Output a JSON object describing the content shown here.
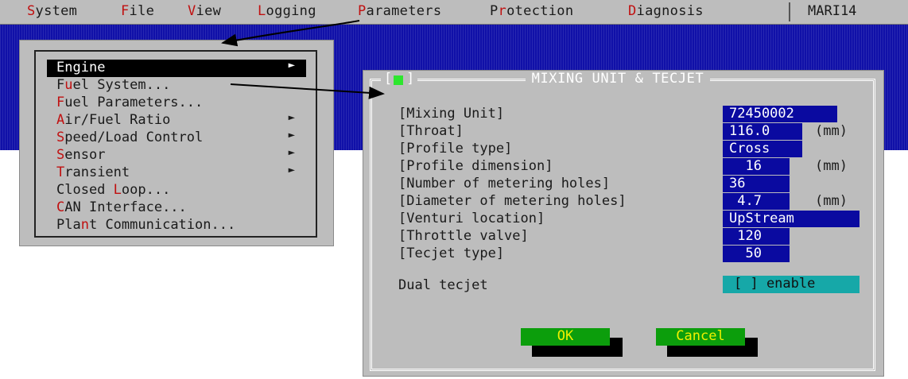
{
  "menubar": {
    "items": [
      {
        "hot": "S",
        "rest": "ystem"
      },
      {
        "hot": "F",
        "rest": "ile"
      },
      {
        "hot": "V",
        "rest": "iew"
      },
      {
        "hot": "L",
        "rest": "ogging"
      },
      {
        "hot": "P",
        "rest": "arameters"
      },
      {
        "pre": "P",
        "hot": "r",
        "rest": "otection"
      },
      {
        "hot": "D",
        "rest": "iagnosis"
      }
    ],
    "app_id": "MARI14"
  },
  "engine_menu": {
    "items": [
      {
        "pre": "",
        "hot": "E",
        "rest": "ngine",
        "arrow": "►"
      },
      {
        "pre": "F",
        "hot": "u",
        "rest": "el System...",
        "arrow": ""
      },
      {
        "pre": "",
        "hot": "F",
        "rest": "uel Parameters...",
        "arrow": ""
      },
      {
        "pre": "",
        "hot": "A",
        "rest": "ir/Fuel Ratio",
        "arrow": "►"
      },
      {
        "pre": "",
        "hot": "S",
        "rest": "peed/Load Control",
        "arrow": "►"
      },
      {
        "pre": "",
        "hot": "S",
        "rest": "ensor",
        "arrow": "►"
      },
      {
        "pre": "",
        "hot": "T",
        "rest": "ransient",
        "arrow": "►"
      },
      {
        "pre": "Closed ",
        "hot": "L",
        "rest": "oop...",
        "arrow": ""
      },
      {
        "pre": "",
        "hot": "C",
        "rest": "AN Interface...",
        "arrow": ""
      },
      {
        "pre": "Pla",
        "hot": "n",
        "rest": "t Communication...",
        "arrow": ""
      }
    ]
  },
  "dialog": {
    "title": "MIXING UNIT & TECJET",
    "close_left": "[",
    "close_right": "]",
    "fields": {
      "mixing_unit": {
        "label": "[Mixing Unit]",
        "value": "72450002",
        "unit": ""
      },
      "throat": {
        "label": "[Throat]",
        "value": "116.0",
        "unit": "(mm)"
      },
      "profile_type": {
        "label": "[Profile type]",
        "value": "Cross",
        "unit": ""
      },
      "profile_dimension": {
        "label": "[Profile dimension]",
        "value": "  16",
        "unit": "(mm)"
      },
      "number_of_metering_holes": {
        "label": "[Number of metering holes]",
        "value": "36",
        "unit": ""
      },
      "diameter_of_metering_holes": {
        "label": "[Diameter of metering holes]",
        "value": " 4.7",
        "unit": "(mm)"
      },
      "venturi_location": {
        "label": "[Venturi location]",
        "value": "UpStream",
        "unit": ""
      },
      "throttle_valve": {
        "label": "[Throttle valve]",
        "value": " 120",
        "unit": ""
      },
      "tecjet_type": {
        "label": "[Tecjet type]",
        "value": "  50",
        "unit": ""
      }
    },
    "dual_tecjet": {
      "label": "Dual tecjet",
      "toggle_text": "[ ] enable"
    },
    "ok_label": "OK",
    "cancel_label": "Cancel"
  }
}
